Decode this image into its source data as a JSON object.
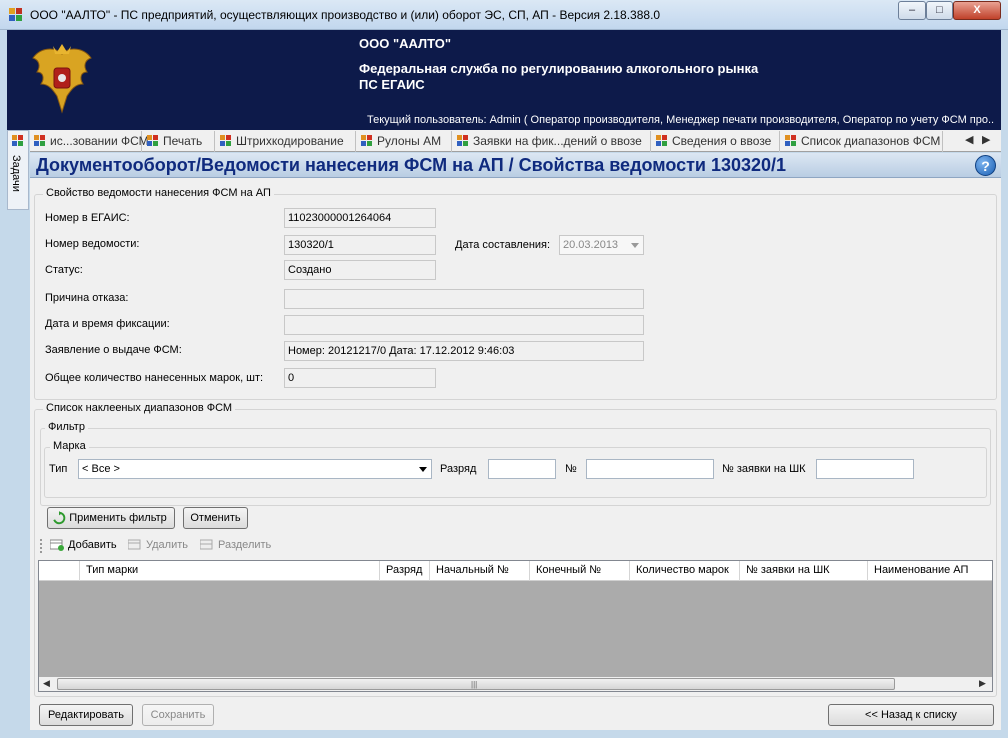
{
  "window": {
    "title": "ООО \"ААЛТО\" - ПС предприятий, осуществляющих производство и (или) оборот ЭС, СП, АП - Версия 2.18.388.0",
    "controls": {
      "minimize": "–",
      "maximize": "□",
      "close": "X"
    }
  },
  "banner": {
    "org": "ООО \"ААЛТО\"",
    "agency_line1": "Федеральная служба по регулированию алкогольного рынка",
    "agency_line2": "ПС ЕГАИС",
    "current_user": "Текущий пользователь: Admin ( Оператор производителя, Менеджер печати производителя, Оператор по учету ФСМ про..."
  },
  "side_panel": {
    "label": "Задачи"
  },
  "tabs": [
    {
      "label": "ис...зовании ФСМ"
    },
    {
      "label": "Печать"
    },
    {
      "label": "Штрихкодирование"
    },
    {
      "label": "Рулоны АМ"
    },
    {
      "label": "Заявки на фик...дений о ввозе"
    },
    {
      "label": "Сведения о ввозе"
    },
    {
      "label": "Список диапазонов ФСМ"
    }
  ],
  "tab_arrows": {
    "left": "◀",
    "right": "▶"
  },
  "page": {
    "title": "Документооборот/Ведомости нанесения ФСМ на АП / Свойства ведомости 130320/1",
    "help": "?"
  },
  "properties": {
    "group_title": "Свойство ведомости нанесения ФСМ на АП",
    "egais_number": {
      "label": "Номер в ЕГАИС:",
      "value": "11023000001264064"
    },
    "statement_number": {
      "label": "Номер ведомости:",
      "value": "130320/1"
    },
    "date_created": {
      "label": "Дата составления:",
      "value": "20.03.2013"
    },
    "status": {
      "label": "Статус:",
      "value": "Создано"
    },
    "reject_reason": {
      "label": "Причина отказа:",
      "value": ""
    },
    "fix_datetime": {
      "label": "Дата и время фиксации:",
      "value": ""
    },
    "fsm_request": {
      "label": "Заявление о выдаче ФСМ:",
      "value": "Номер: 20121217/0 Дата: 17.12.2012 9:46:03"
    },
    "total_marks": {
      "label": "Общее количество нанесенных марок, шт:",
      "value": "0"
    }
  },
  "ranges": {
    "group_title": "Список наклееных диапазонов ФСМ",
    "filter": {
      "title": "Фильтр",
      "mark_group": "Марка",
      "type_label": "Тип",
      "type_value": "< Все >",
      "rank_label": "Разряд",
      "rank_value": "",
      "number_label": "№",
      "number_value": "",
      "request_label": "№ заявки на ШК",
      "request_value": "",
      "apply_button": "Применить фильтр",
      "cancel_button": "Отменить"
    },
    "toolbar": {
      "add": "Добавить",
      "delete": "Удалить",
      "split": "Разделить"
    },
    "columns": [
      "Тип марки",
      "Разряд",
      "Начальный №",
      "Конечный №",
      "Количество марок",
      "№ заявки на ШК",
      "Наименование АП"
    ]
  },
  "footer": {
    "edit_button": "Редактировать",
    "save_button": "Сохранить",
    "back_button": "<< Назад к списку"
  },
  "colors": {
    "banner_bg": "#0d1a4a",
    "title_blue": "#0f2a7e",
    "grid_empty": "#ababab"
  }
}
